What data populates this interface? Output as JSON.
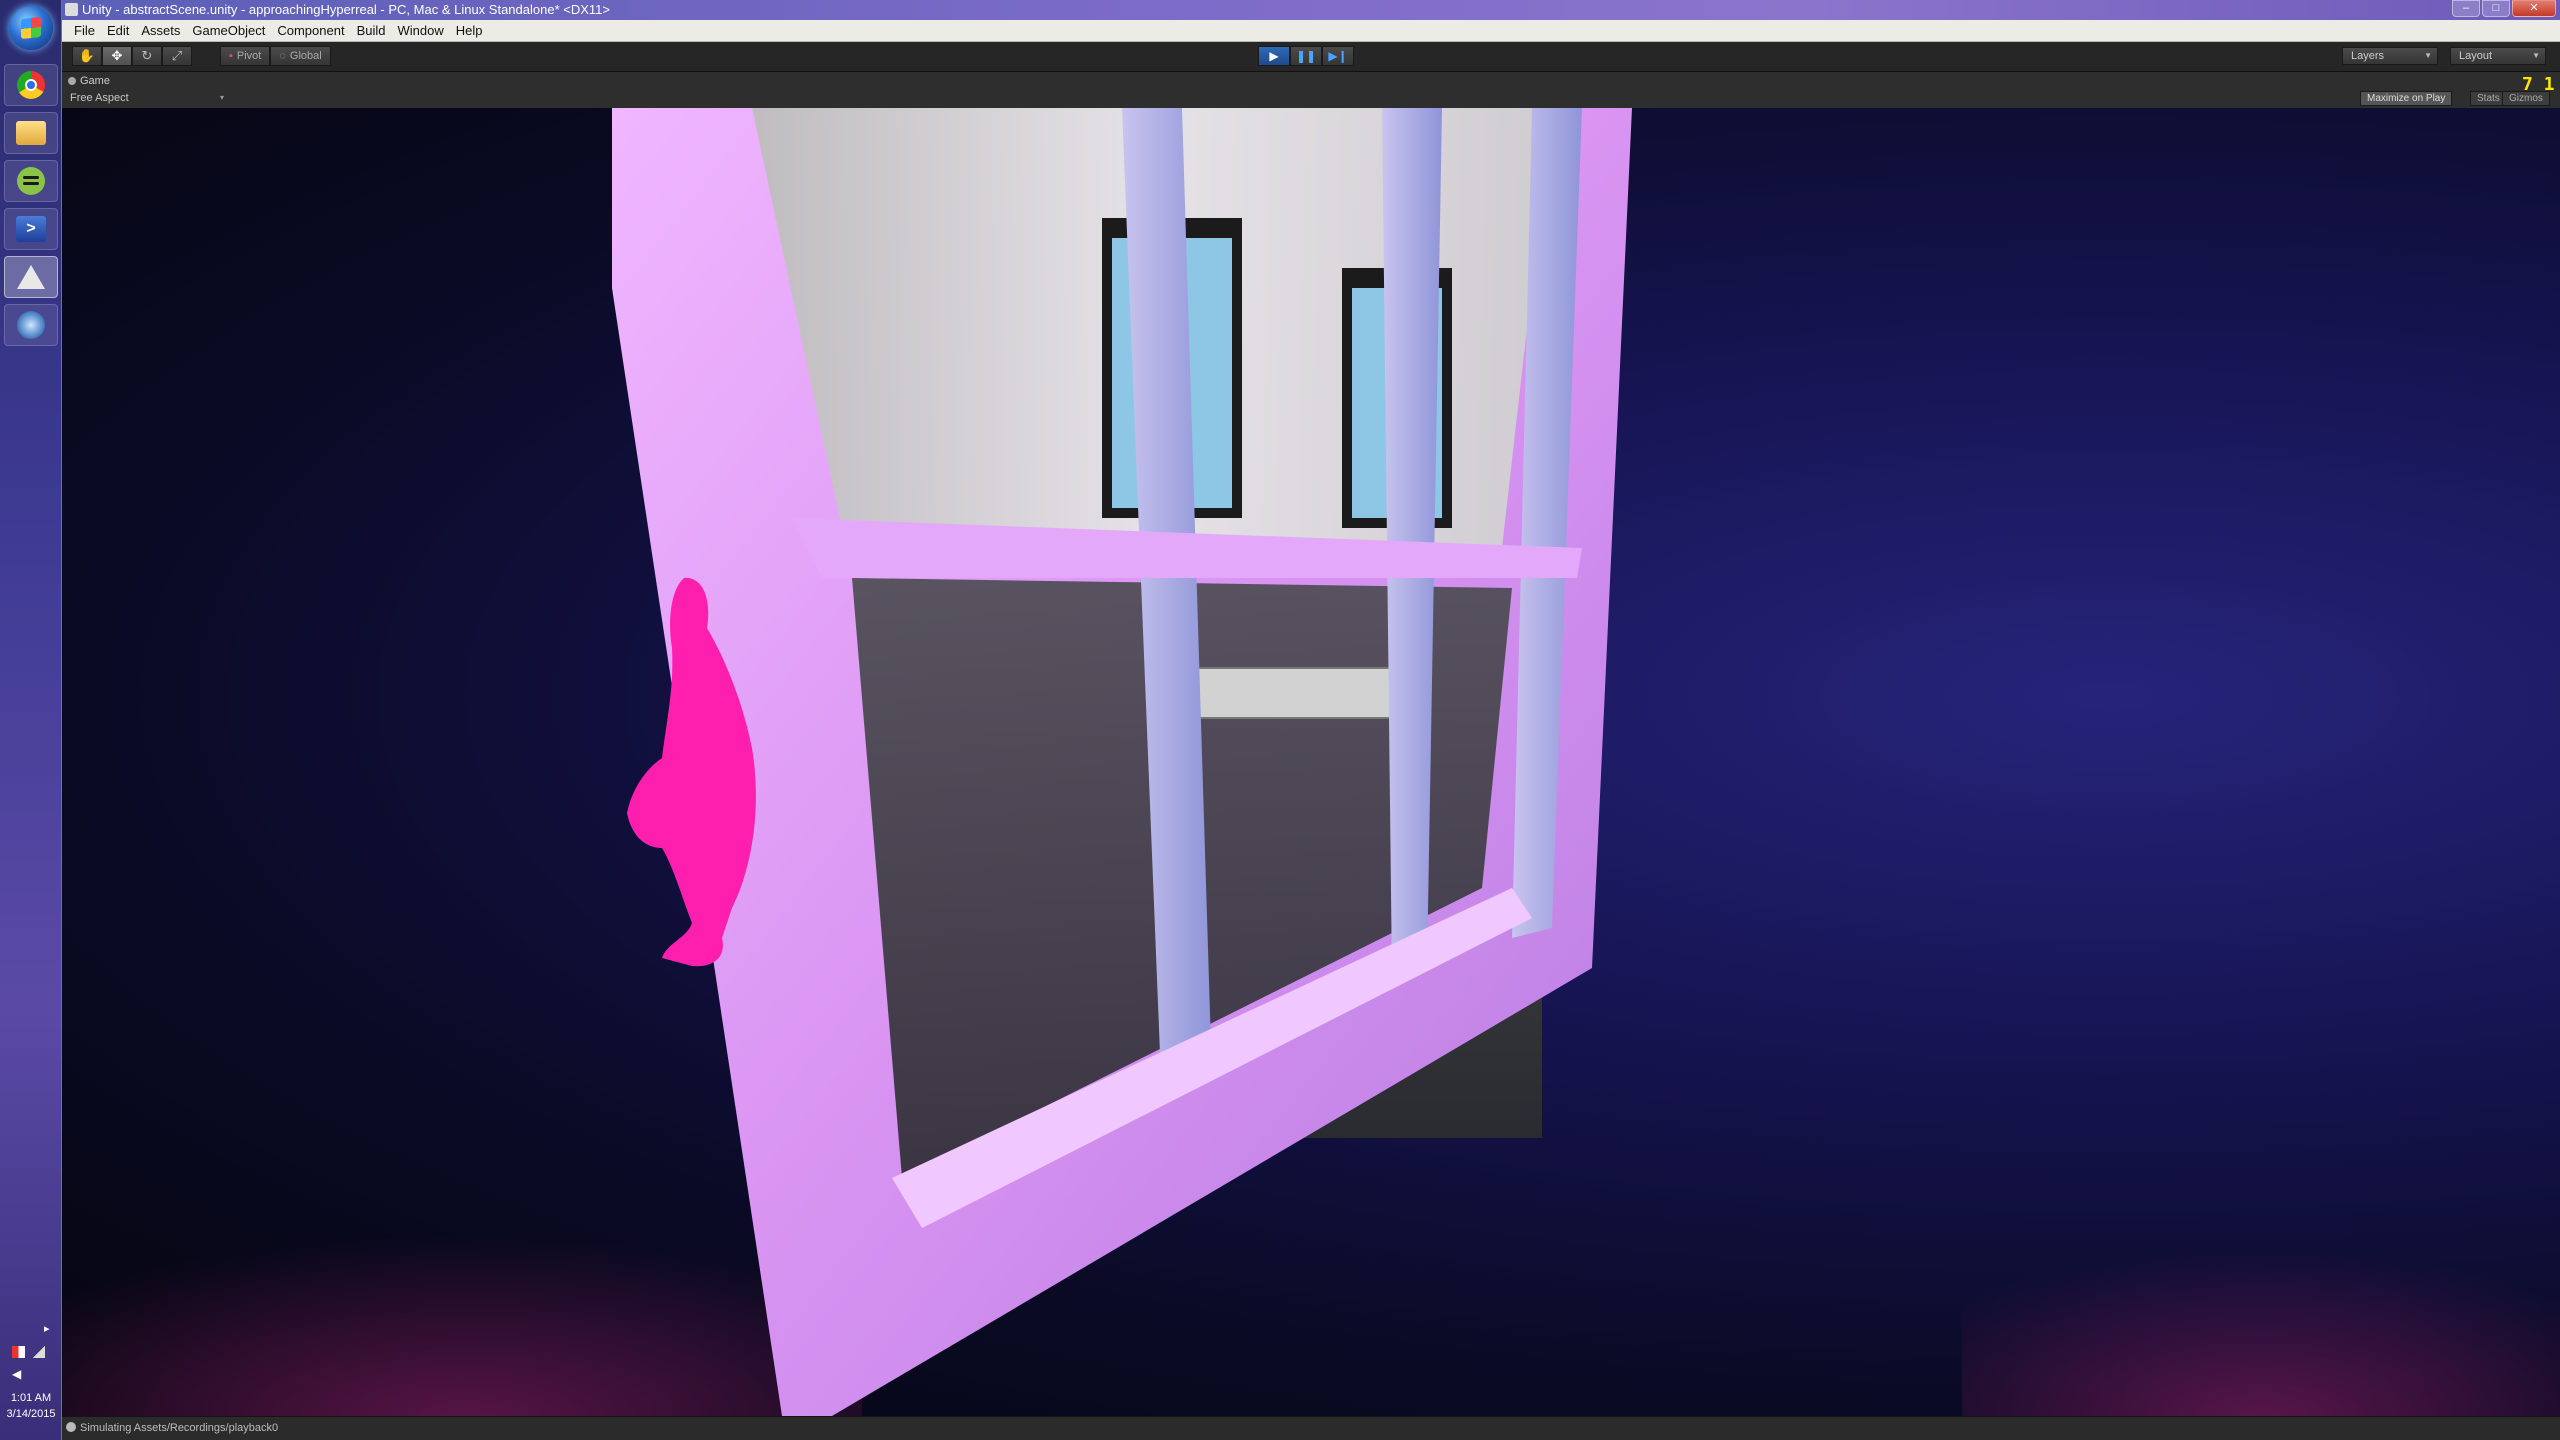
{
  "window": {
    "title": "Unity - abstractScene.unity - approachingHyperreal - PC, Mac & Linux Standalone* <DX11>",
    "minimize": "–",
    "maximize": "□",
    "close": "✕"
  },
  "menubar": [
    "File",
    "Edit",
    "Assets",
    "GameObject",
    "Component",
    "Build",
    "Window",
    "Help"
  ],
  "toolbar": {
    "transform_tools": [
      "hand-icon",
      "move-icon",
      "rotate-icon",
      "scale-icon"
    ],
    "pivot_label": "Pivot",
    "global_label": "Global",
    "play_state": "playing",
    "layers_label": "Layers",
    "layout_label": "Layout"
  },
  "game_view": {
    "tab_label": "Game",
    "aspect_label": "Free Aspect",
    "maximize_label": "Maximize on Play",
    "stats_label": "Stats",
    "gizmos_label": "Gizmos",
    "fps_overlay": "7 1"
  },
  "status": {
    "message": "Simulating Assets/Recordings/playback0"
  },
  "taskbar": {
    "apps": [
      "chrome-icon",
      "file-explorer-icon",
      "spotify-icon",
      "powershell-icon",
      "unity-icon",
      "network-app-icon"
    ],
    "time": "1:01 AM",
    "date": "3/14/2015"
  },
  "colors": {
    "frame": "#e7a6ff",
    "figure": "#ff1fae",
    "background": "#161452",
    "play_active": "#2e6ab8"
  }
}
